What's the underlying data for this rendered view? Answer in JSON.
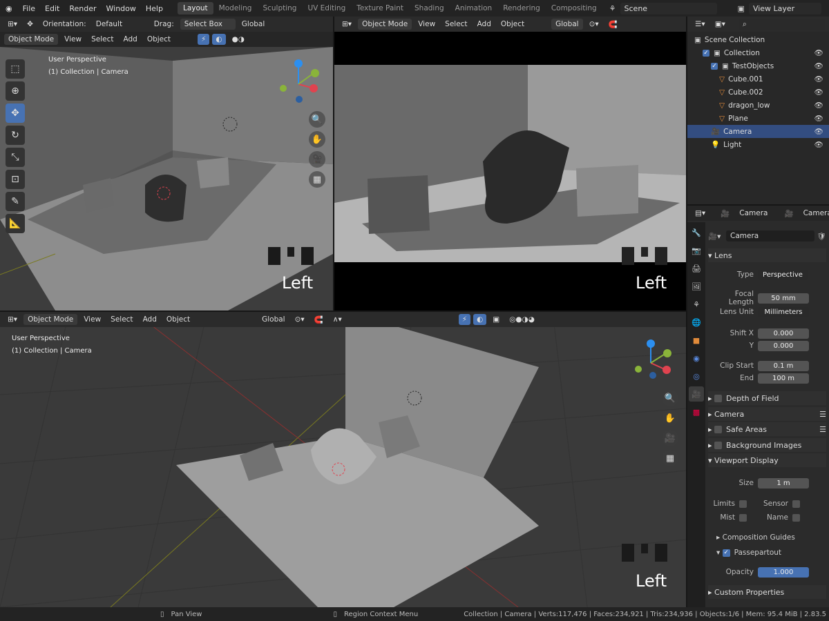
{
  "menu": [
    "File",
    "Edit",
    "Render",
    "Window",
    "Help"
  ],
  "workspaces": [
    "Layout",
    "Modeling",
    "Sculpting",
    "UV Editing",
    "Texture Paint",
    "Shading",
    "Animation",
    "Rendering",
    "Compositing"
  ],
  "active_workspace": "Layout",
  "scene": "Scene",
  "view_layer": "View Layer",
  "tool_header": {
    "orientation_label": "Orientation:",
    "orientation": "Default",
    "drag_label": "Drag:",
    "drag": "Select Box",
    "transform": "Global"
  },
  "vp_header": {
    "mode": "Object Mode",
    "view": "View",
    "select": "Select",
    "add": "Add",
    "object": "Object",
    "global": "Global"
  },
  "viewport_overlay": {
    "perspective": "User Perspective",
    "collection": "(1) Collection | Camera",
    "label": "Left"
  },
  "outliner": {
    "items": [
      {
        "label": "Scene Collection",
        "indent": 0
      },
      {
        "label": "Collection",
        "indent": 1
      },
      {
        "label": "TestObjects",
        "indent": 2
      },
      {
        "label": "Cube.001",
        "indent": 3
      },
      {
        "label": "Cube.002",
        "indent": 3
      },
      {
        "label": "dragon_low",
        "indent": 3
      },
      {
        "label": "Plane",
        "indent": 3
      },
      {
        "label": "Camera",
        "indent": 2,
        "selected": true
      },
      {
        "label": "Light",
        "indent": 2
      }
    ]
  },
  "properties": {
    "breadcrumb": [
      "Camera",
      "Camera"
    ],
    "datablock": "Camera",
    "lens": {
      "title": "Lens",
      "type_label": "Type",
      "type": "Perspective",
      "focal_label": "Focal Length",
      "focal": "50 mm",
      "unit_label": "Lens Unit",
      "unit": "Millimeters",
      "shiftx_label": "Shift X",
      "shiftx": "0.000",
      "shifty_label": "Y",
      "shifty": "0.000",
      "clipstart_label": "Clip Start",
      "clipstart": "0.1 m",
      "end_label": "End",
      "end": "100 m"
    },
    "dof": "Depth of Field",
    "camera": "Camera",
    "safe_areas": "Safe Areas",
    "background_images": "Background Images",
    "viewport_display": {
      "title": "Viewport Display",
      "size_label": "Size",
      "size": "1 m",
      "limits": "Limits",
      "sensor": "Sensor",
      "mist": "Mist",
      "name": "Name",
      "composition_guides": "Composition Guides",
      "passepartout": "Passepartout",
      "opacity_label": "Opacity",
      "opacity": "1.000"
    },
    "custom_properties": "Custom Properties"
  },
  "status": {
    "pan": "Pan View",
    "context": "Region Context Menu",
    "stats": "Collection | Camera | Verts:117,476 | Faces:234,921 | Tris:234,936 | Objects:1/6 | Mem: 95.4 MiB | 2.83.5"
  },
  "colors": {
    "accent": "#4772b3",
    "selected_row": "#334d80",
    "axis_x": "#e0434f",
    "axis_y": "#8ab43a",
    "axis_z": "#2c8ff0"
  }
}
